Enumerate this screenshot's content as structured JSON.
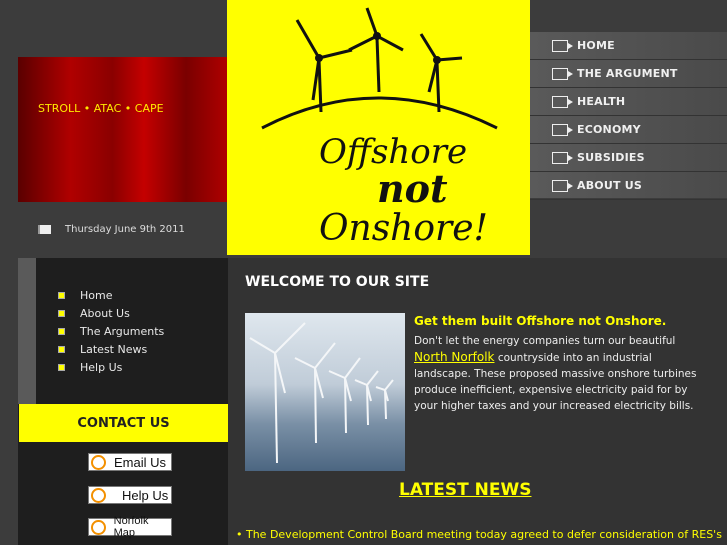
{
  "banner": {
    "tagline": "STROLL • ATAC • CAPE",
    "date": "Thursday June 9th 2011"
  },
  "logo": {
    "line1": "Offshore",
    "line2": "not",
    "line3": "Onshore!"
  },
  "topnav": {
    "items": [
      {
        "label": "HOME"
      },
      {
        "label": "THE ARGUMENT"
      },
      {
        "label": "HEALTH"
      },
      {
        "label": "ECONOMY"
      },
      {
        "label": "SUBSIDIES"
      },
      {
        "label": "ABOUT US"
      }
    ]
  },
  "leftmenu": {
    "items": [
      {
        "label": "Home"
      },
      {
        "label": "About Us"
      },
      {
        "label": "The Arguments"
      },
      {
        "label": "Latest News"
      },
      {
        "label": "Help Us"
      }
    ]
  },
  "contact": {
    "title": "CONTACT US",
    "buttons": [
      "Email Us",
      "Help Us",
      "Norfolk Map"
    ]
  },
  "main": {
    "welcome": "WELCOME TO OUR SITE",
    "headline": "Get them built Offshore not Onshore.",
    "body_pre": "Don't let the energy companies turn our beautiful ",
    "body_link": "North Norfolk",
    "body_post": " countryside into an industrial landscape. These proposed massive onshore turbines produce inefficient, expensive electricity paid for by your higher taxes and your increased electricity bills.",
    "latest_news": "LATEST NEWS",
    "news_item": "• The Development Control Board meeting today agreed to defer consideration of RES's"
  },
  "colors": {
    "accent": "#ffff00",
    "banner_red": "#b00000",
    "bg": "#3c3c3c"
  }
}
